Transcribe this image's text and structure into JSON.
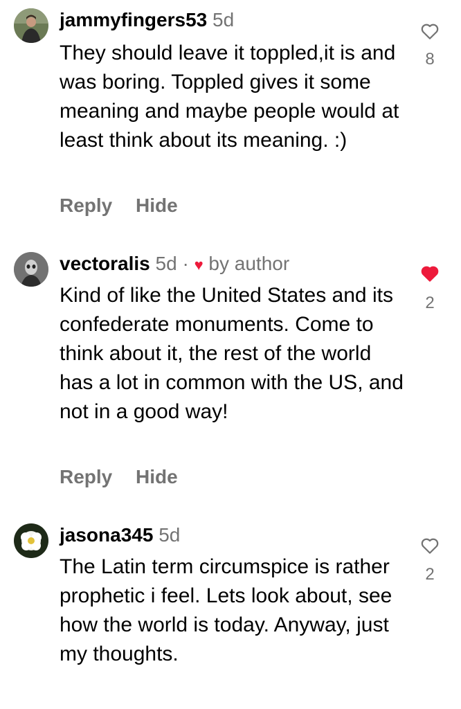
{
  "comments": [
    {
      "username": "jammyfingers53",
      "time": "5d",
      "text": "They should leave it toppled,it is and was boring. Toppled gives it some meaning and maybe people would at least think about its meaning. :)",
      "reply_label": "Reply",
      "hide_label": "Hide",
      "likes": "8",
      "liked": false
    },
    {
      "username": "vectoralis",
      "time": "5d",
      "separator": "·",
      "liked_by_author_label": "by author",
      "text": "Kind of like the United States and its confederate monuments. Come to think about it, the rest of the world has a lot in common with the US, and not in a good way!",
      "reply_label": "Reply",
      "hide_label": "Hide",
      "likes": "2",
      "liked": true
    },
    {
      "username": "jasona345",
      "time": "5d",
      "text": "The Latin term circumspice is rather prophetic i feel.  Lets look about, see how the world is today. Anyway, just my thoughts.",
      "likes": "2",
      "liked": false
    }
  ],
  "colors": {
    "text": "#000000",
    "secondary": "#737373",
    "like_red": "#ed1a3b"
  }
}
